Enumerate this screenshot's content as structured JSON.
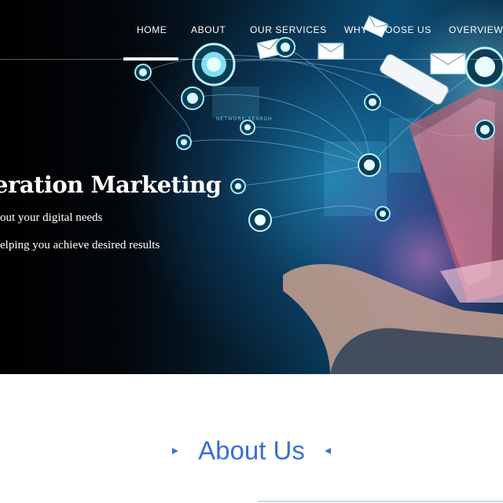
{
  "nav": {
    "items": [
      {
        "label": "HOME",
        "active": true
      },
      {
        "label": "ABOUT"
      },
      {
        "label": "OUR SERVICES"
      },
      {
        "label": "WHY CHOOSE US"
      },
      {
        "label": "OVERVIEW"
      }
    ]
  },
  "hero": {
    "title": "eration Marketing",
    "subtitle_1": "out your digital needs",
    "subtitle_2": "elping you achieve desired results",
    "graphic_labels": [
      "NETWORK SEARCH"
    ]
  },
  "about": {
    "heading": "About Us",
    "arrow_left": "▸",
    "arrow_right": "◂"
  },
  "colors": {
    "accent": "#3b6fd6",
    "nav_text": "#ffffff",
    "hero_dark": "#000000",
    "hero_cyan": "#2aa8e0",
    "node_glow": "#bff4ff"
  }
}
